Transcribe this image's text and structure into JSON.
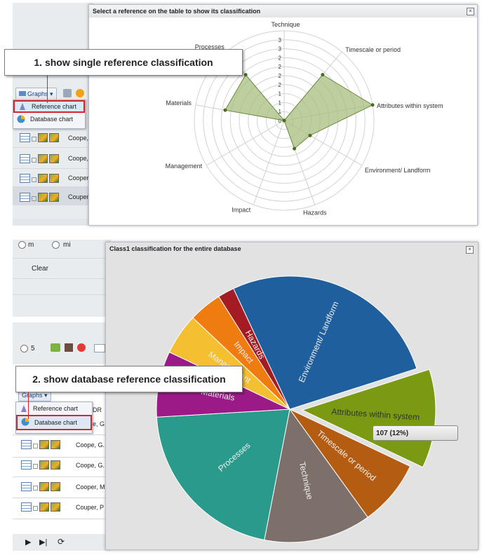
{
  "callouts": {
    "step1": "1.  show single reference classification",
    "step2": "2.  show database reference classification"
  },
  "top_panel": {
    "graphs_button": "Graphs",
    "menu": [
      {
        "label": "Reference chart",
        "icon": "reference-chart-icon",
        "highlighted": true
      },
      {
        "label": "Database chart",
        "icon": "database-chart-icon",
        "highlighted": false
      }
    ],
    "rows": [
      "Coope,",
      "Coope,",
      "Cooper",
      "Couper"
    ]
  },
  "bottom_panel": {
    "radio_m": "m",
    "radio_mi": "mi",
    "clear_label": "Clear",
    "radio_5": "5",
    "graphs_button": "Graphs",
    "column_header": "DR",
    "menu": [
      {
        "label": "Reference chart",
        "icon": "reference-chart-icon",
        "highlighted": false
      },
      {
        "label": "Database chart",
        "icon": "database-chart-icon",
        "highlighted": true
      }
    ],
    "rows": [
      "e, G.",
      "Coope, G.",
      "Coope, G.",
      "Cooper, M",
      "Couper, P"
    ]
  },
  "radar_window": {
    "title": "Select a reference on the table to show its classification",
    "close": "×"
  },
  "pie_window": {
    "title": "Class1 classification for the entire database",
    "close": "×",
    "tooltip": "107 (12%)"
  },
  "chart_data": [
    {
      "type": "radar",
      "axes": [
        "Technique",
        "Timescale or period",
        "Attributes within system",
        "Environment/ Landform",
        "Hazards",
        "Impact",
        "Management",
        "Materials",
        "Processes"
      ],
      "values": [
        0,
        2,
        3,
        1,
        1,
        0,
        0,
        2,
        2
      ],
      "radial_tick_labels": [
        "0",
        "1",
        "1",
        "1",
        "2",
        "2",
        "2",
        "2",
        "3",
        "3"
      ],
      "rmax": 3,
      "rings": 10,
      "fill_color": "#a7bd7f",
      "stroke_color": "#6e8b3d"
    },
    {
      "type": "pie",
      "slices": [
        {
          "label": "Environment/ Landform",
          "value": 27,
          "color": "#1f5f9e"
        },
        {
          "label": "Attributes within system",
          "value": 12,
          "color": "#7a9a14",
          "exploded": true
        },
        {
          "label": "Timescale or period",
          "value": 8,
          "color": "#b45d12"
        },
        {
          "label": "Technique",
          "value": 13,
          "color": "#7d706b"
        },
        {
          "label": "Processes",
          "value": 21,
          "color": "#2a9a8c"
        },
        {
          "label": "Materials",
          "value": 8,
          "color": "#9b1a88"
        },
        {
          "label": "Management",
          "value": 5,
          "color": "#f4bf30"
        },
        {
          "label": "Impact",
          "value": 4,
          "color": "#ef7c10"
        },
        {
          "label": "Hazards",
          "value": 2,
          "color": "#a51b24"
        }
      ]
    }
  ]
}
